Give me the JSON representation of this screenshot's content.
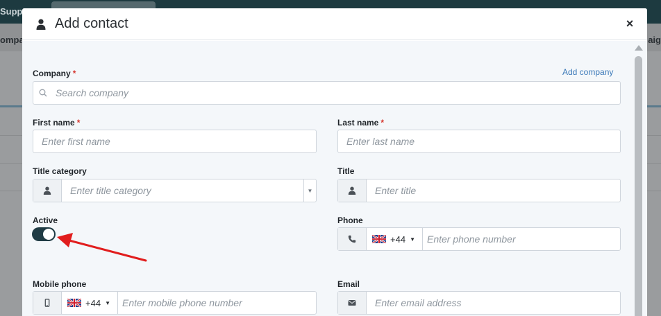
{
  "background": {
    "topbar_text": "Suppo",
    "nav_left": "ompa",
    "nav_right": "aig"
  },
  "modal": {
    "title": "Add contact",
    "close_label": "×"
  },
  "form": {
    "company": {
      "label": "Company",
      "required_mark": "*",
      "placeholder": "Search company",
      "add_link": "Add company"
    },
    "first_name": {
      "label": "First name",
      "required_mark": "*",
      "placeholder": "Enter first name"
    },
    "last_name": {
      "label": "Last name",
      "required_mark": "*",
      "placeholder": "Enter last name"
    },
    "title_category": {
      "label": "Title category",
      "placeholder": "Enter title category"
    },
    "title": {
      "label": "Title",
      "placeholder": "Enter title"
    },
    "active": {
      "label": "Active",
      "value": true
    },
    "phone": {
      "label": "Phone",
      "dial_code": "+44",
      "placeholder": "Enter phone number"
    },
    "mobile_phone": {
      "label": "Mobile phone",
      "dial_code": "+44",
      "placeholder": "Enter mobile phone number"
    },
    "email": {
      "label": "Email",
      "placeholder": "Enter email address"
    }
  },
  "colors": {
    "accent_dark": "#1f3b44",
    "link": "#3a78b8",
    "required": "#d6342c",
    "annotation_arrow": "#e11d1d"
  },
  "icons": {
    "header": "user-icon",
    "close": "close-icon",
    "search": "search-icon",
    "phone": "phone-icon",
    "mobile": "mobile-icon",
    "email": "envelope-icon",
    "flag": "uk-flag-icon"
  }
}
